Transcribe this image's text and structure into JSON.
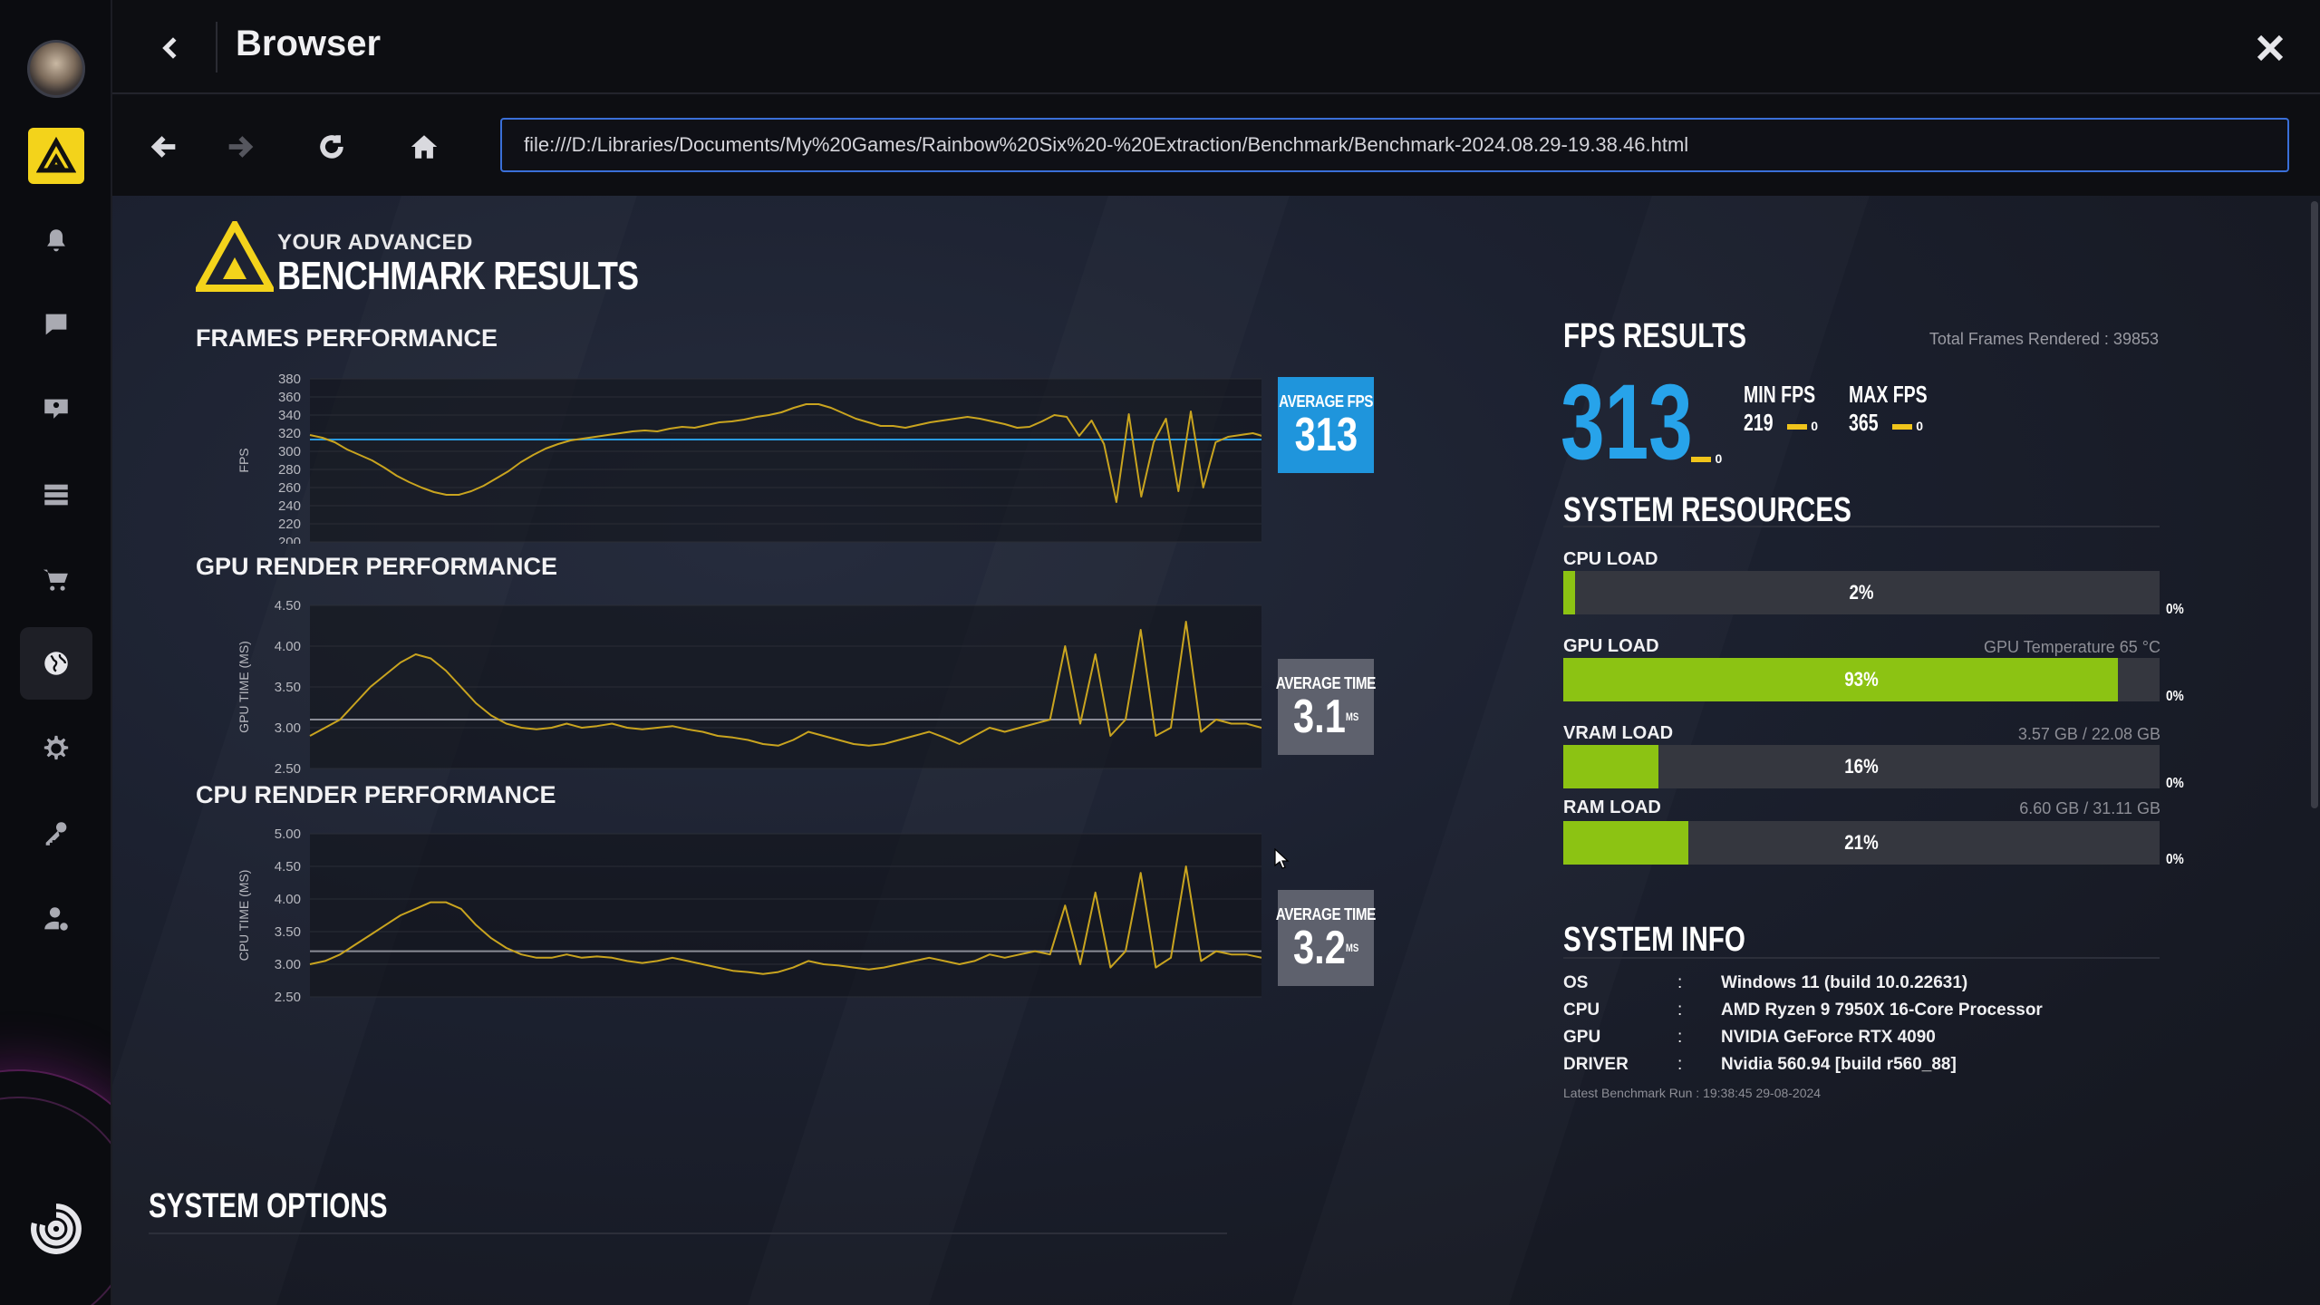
{
  "header": {
    "title": "Browser"
  },
  "toolbar": {
    "url": "file:///D:/Libraries/Documents/My%20Games/Rainbow%20Six%20-%20Extraction/Benchmark/Benchmark-2024.08.29-19.38.46.html"
  },
  "sidebar": {
    "items": [
      {
        "icon": "avatar"
      },
      {
        "icon": "game-app-icon"
      },
      {
        "icon": "bell-icon"
      },
      {
        "icon": "chat-icon"
      },
      {
        "icon": "friends-chat-icon"
      },
      {
        "icon": "library-icon"
      },
      {
        "icon": "cart-icon"
      },
      {
        "icon": "globe-icon"
      },
      {
        "icon": "gear-icon"
      },
      {
        "icon": "key-icon"
      },
      {
        "icon": "user-settings-icon"
      },
      {
        "icon": "ubisoft-logo"
      }
    ]
  },
  "brand": {
    "line1": "YOUR ADVANCED",
    "line2": "BENCHMARK RESULTS"
  },
  "charts": {
    "frames": {
      "heading": "FRAMES PERFORMANCE",
      "ylabel": "FPS",
      "avg_label": "AVERAGE FPS",
      "avg_value": "313",
      "avg_unit": ""
    },
    "gpu": {
      "heading": "GPU RENDER PERFORMANCE",
      "ylabel": "GPU TIME (MS)",
      "avg_label": "AVERAGE TIME",
      "avg_value": "3.1",
      "avg_unit": "MS"
    },
    "cpu": {
      "heading": "CPU RENDER PERFORMANCE",
      "ylabel": "CPU TIME (MS)",
      "avg_label": "AVERAGE TIME",
      "avg_value": "3.2",
      "avg_unit": "MS"
    }
  },
  "chart_data": [
    {
      "type": "line",
      "title": "FRAMES PERFORMANCE",
      "ylabel": "FPS",
      "ylim": [
        200,
        380
      ],
      "yticks": [
        "380",
        "360",
        "340",
        "320",
        "300",
        "280",
        "260",
        "240",
        "220",
        "200"
      ],
      "average": 313,
      "series": [
        {
          "values": [
            318,
            315,
            310,
            302,
            296,
            290,
            282,
            273,
            266,
            260,
            255,
            252,
            252,
            256,
            262,
            270,
            278,
            288,
            296,
            303,
            308,
            312,
            314,
            316,
            318,
            320,
            322,
            323,
            322,
            325,
            327,
            326,
            329,
            332,
            333,
            335,
            338,
            340,
            343,
            348,
            352,
            352,
            348,
            342,
            336,
            332,
            328,
            328,
            326,
            329,
            332,
            334,
            336,
            338,
            336,
            333,
            330,
            326,
            327,
            333,
            340,
            338,
            317,
            334,
            308,
            244,
            341,
            250,
            310,
            336,
            256,
            344,
            260,
            310,
            316,
            318,
            320,
            316,
            318,
            320,
            318,
            316,
            318,
            320,
            316
          ]
        }
      ]
    },
    {
      "type": "line",
      "title": "GPU RENDER PERFORMANCE",
      "ylabel": "GPU TIME (MS)",
      "ylim": [
        2.5,
        4.5
      ],
      "yticks": [
        "4.50",
        "4.00",
        "3.50",
        "3.00",
        "2.50"
      ],
      "average": 3.1,
      "series": [
        {
          "values": [
            2.9,
            3.0,
            3.1,
            3.3,
            3.5,
            3.65,
            3.8,
            3.9,
            3.85,
            3.7,
            3.5,
            3.3,
            3.15,
            3.05,
            3.0,
            2.98,
            3.0,
            3.05,
            3.0,
            3.02,
            3.05,
            3.0,
            2.98,
            3.0,
            3.02,
            2.98,
            2.95,
            2.9,
            2.88,
            2.85,
            2.8,
            2.78,
            2.85,
            2.95,
            2.9,
            2.85,
            2.8,
            2.78,
            2.8,
            2.85,
            2.9,
            2.95,
            2.88,
            2.8,
            2.9,
            3.0,
            2.95,
            3.0,
            3.05,
            3.1,
            4.0,
            3.05,
            3.9,
            2.9,
            3.1,
            4.2,
            2.9,
            3.0,
            4.3,
            2.95,
            3.1,
            3.05,
            3.05,
            3.0,
            3.02,
            3.05,
            3.0,
            2.98,
            3.0,
            3.05
          ]
        }
      ]
    },
    {
      "type": "line",
      "title": "CPU RENDER PERFORMANCE",
      "ylabel": "CPU TIME (MS)",
      "ylim": [
        2.5,
        5.0
      ],
      "yticks": [
        "5.00",
        "4.50",
        "4.00",
        "3.50",
        "3.00",
        "2.50"
      ],
      "average": 3.2,
      "series": [
        {
          "values": [
            3.0,
            3.05,
            3.15,
            3.3,
            3.45,
            3.6,
            3.75,
            3.85,
            3.95,
            3.95,
            3.85,
            3.6,
            3.4,
            3.25,
            3.15,
            3.1,
            3.1,
            3.15,
            3.1,
            3.12,
            3.1,
            3.05,
            3.02,
            3.05,
            3.1,
            3.05,
            3.0,
            2.95,
            2.9,
            2.88,
            2.85,
            2.88,
            2.95,
            3.05,
            3.0,
            2.98,
            2.95,
            2.92,
            2.95,
            3.0,
            3.05,
            3.1,
            3.05,
            3.0,
            3.05,
            3.15,
            3.1,
            3.15,
            3.2,
            3.15,
            3.9,
            3.0,
            4.1,
            2.95,
            3.2,
            4.4,
            2.95,
            3.1,
            4.5,
            3.05,
            3.2,
            3.15,
            3.15,
            3.1,
            3.12,
            3.15,
            3.1,
            3.08,
            3.1,
            3.15
          ]
        }
      ]
    }
  ],
  "fps": {
    "title": "FPS RESULTS",
    "total_frames": "Total Frames Rendered : 39853",
    "average": "313",
    "average_zero": "0",
    "min_label": "MIN FPS",
    "min_value": "219",
    "min_zero": "0",
    "max_label": "MAX FPS",
    "max_value": "365",
    "max_zero": "0",
    "accent": "#27a3ea"
  },
  "resources": {
    "title": "SYSTEM RESOURCES",
    "items": [
      {
        "label": "CPU LOAD",
        "note": "",
        "pct_text": "2%",
        "fraction": 0.02,
        "zero": "0%"
      },
      {
        "label": "GPU LOAD",
        "note": "GPU Temperature 65 °C",
        "pct_text": "93%",
        "fraction": 0.93,
        "zero": "0%"
      },
      {
        "label": "VRAM LOAD",
        "note": "3.57 GB / 22.08 GB",
        "pct_text": "16%",
        "fraction": 0.16,
        "zero": "0%"
      },
      {
        "label": "RAM LOAD",
        "note": "6.60 GB / 31.11 GB",
        "pct_text": "21%",
        "fraction": 0.21,
        "zero": "0%"
      }
    ],
    "bar_color": "#8cc313"
  },
  "sysinfo": {
    "title": "SYSTEM INFO",
    "rows": [
      {
        "key": "OS",
        "sep": ":",
        "value": "Windows 11 (build 10.0.22631)"
      },
      {
        "key": "CPU",
        "sep": ":",
        "value": "AMD Ryzen 9 7950X 16-Core Processor"
      },
      {
        "key": "GPU",
        "sep": ":",
        "value": "NVIDIA GeForce RTX 4090"
      },
      {
        "key": "DRIVER",
        "sep": ":",
        "value": "Nvidia 560.94 [build r560_88]"
      }
    ],
    "latest_run": "Latest Benchmark Run : 19:38:45 29-08-2024"
  },
  "system_options": {
    "title": "SYSTEM OPTIONS"
  },
  "colors": {
    "line": "#c9a41f",
    "avg_line": "#2a9be0",
    "avg_grey": "#8a8c96"
  }
}
